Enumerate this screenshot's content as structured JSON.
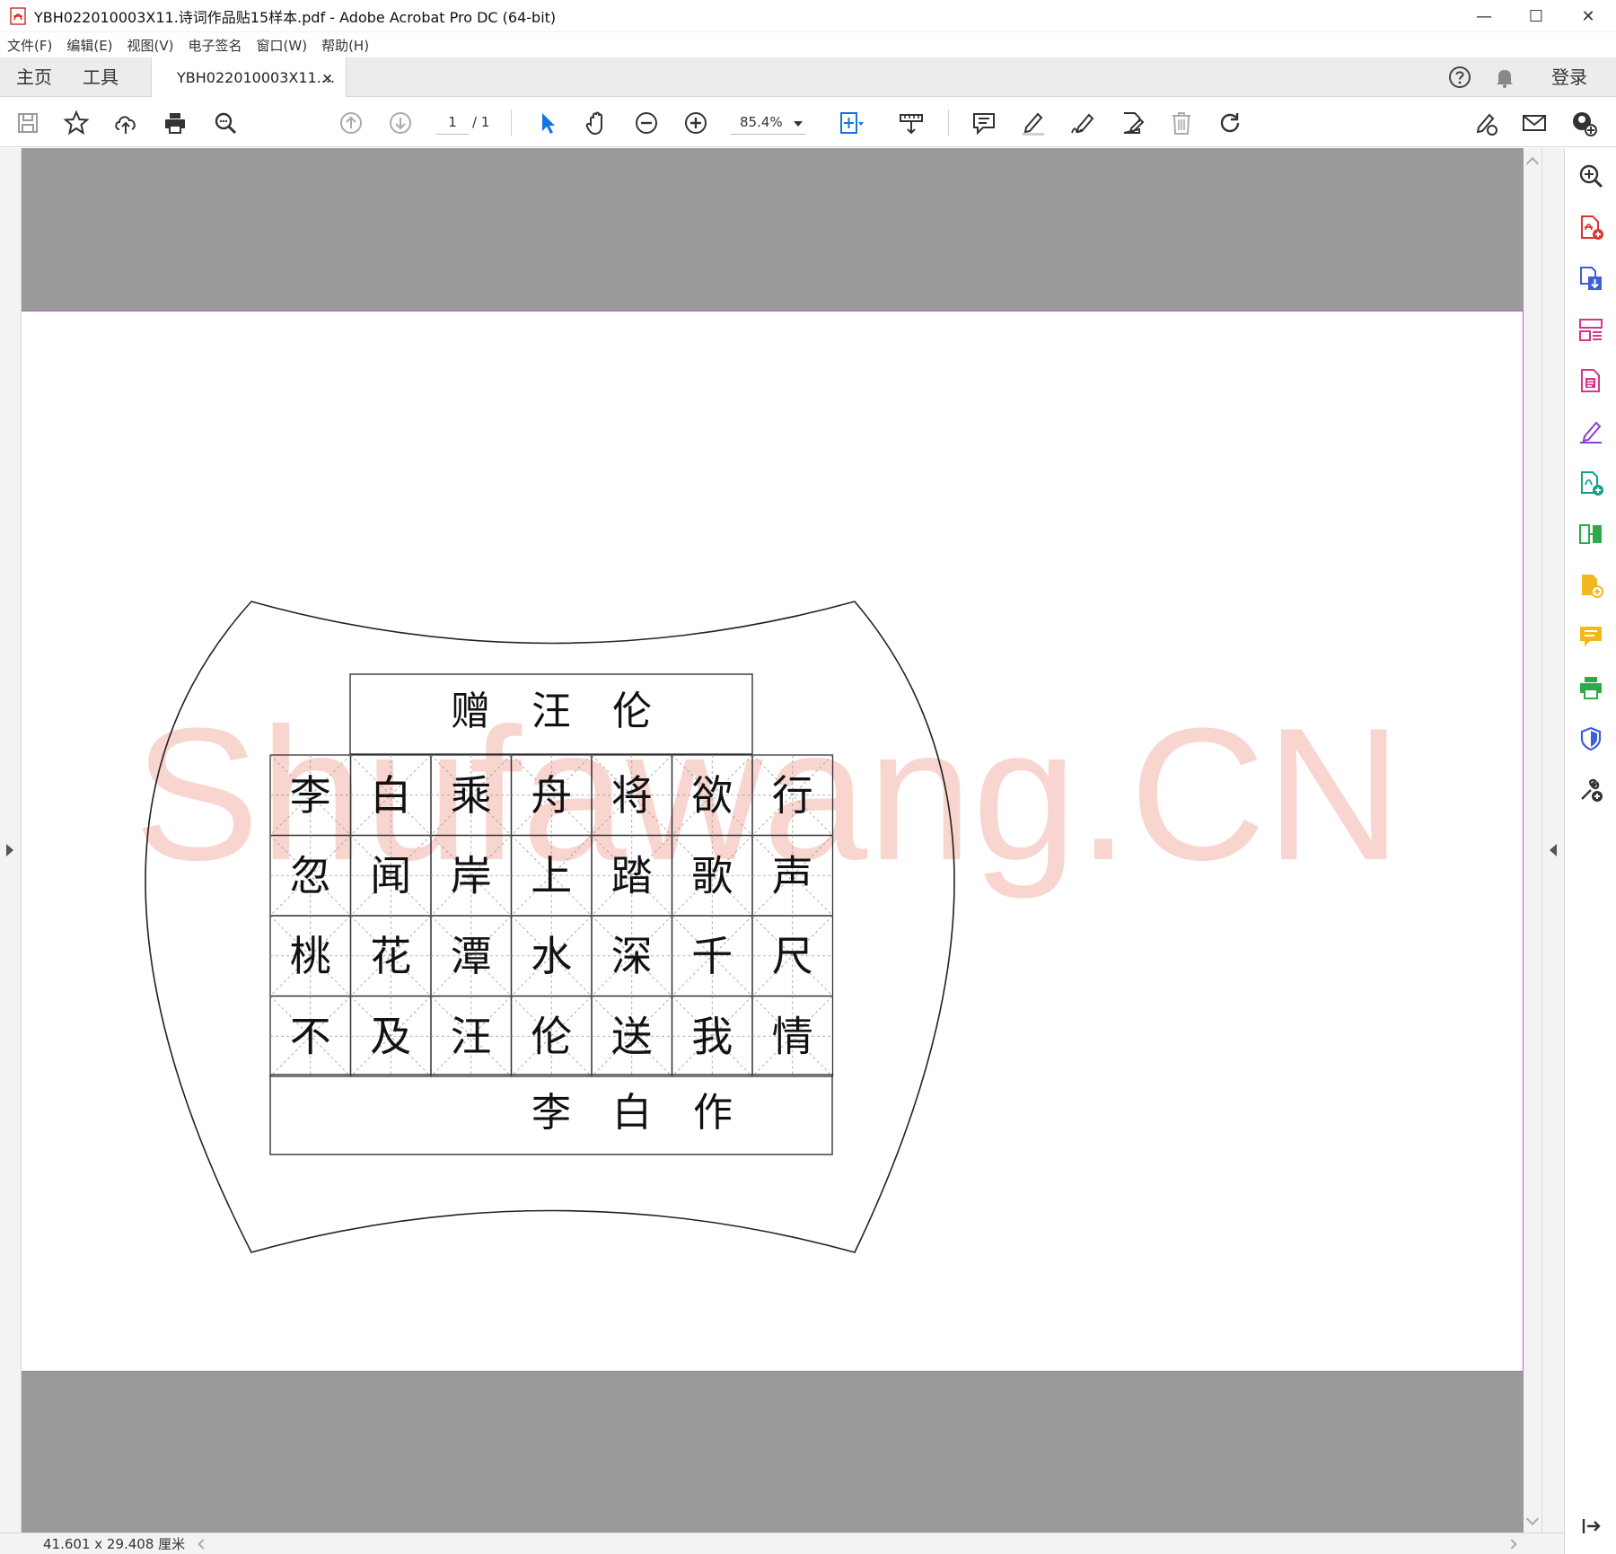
{
  "window": {
    "title": "YBH022010003X11.诗词作品贴15样本.pdf - Adobe Acrobat Pro DC (64-bit)",
    "controls": {
      "minimize": "—",
      "maximize": "☐",
      "close": "✕"
    }
  },
  "menu": [
    "文件(F)",
    "编辑(E)",
    "视图(V)",
    "电子签名",
    "窗口(W)",
    "帮助(H)"
  ],
  "tabs": {
    "home": "主页",
    "tools": "工具",
    "document": "YBH022010003X11....",
    "close": "×",
    "signin": "登录"
  },
  "toolbar": {
    "page_current": "1",
    "page_total": "/ 1",
    "zoom": "85.4%"
  },
  "document": {
    "poem_title": [
      "赠",
      "汪",
      "伦"
    ],
    "poem_rows": [
      [
        "李",
        "白",
        "乘",
        "舟",
        "将",
        "欲",
        "行"
      ],
      [
        "忽",
        "闻",
        "岸",
        "上",
        "踏",
        "歌",
        "声"
      ],
      [
        "桃",
        "花",
        "潭",
        "水",
        "深",
        "千",
        "尺"
      ],
      [
        "不",
        "及",
        "汪",
        "伦",
        "送",
        "我",
        "情"
      ]
    ],
    "signature": [
      "李",
      "白",
      "作"
    ],
    "watermark": "Shufawang.CN"
  },
  "status": {
    "dimensions": "41.601 x 29.408 厘米"
  },
  "colors": {
    "accent_blue": "#1473e6",
    "watermark": "#f6c8c0",
    "page_border": "#c65bc6",
    "canvas_bg": "#9a9a9a"
  },
  "right_tools": [
    "enhance-scans-icon",
    "create-pdf-icon",
    "export-pdf-icon",
    "organize-pages-icon",
    "edit-pdf-icon",
    "fill-sign-icon",
    "combine-files-icon",
    "compare-files-icon",
    "create-pdf-plus-icon",
    "comment-icon",
    "print-production-icon",
    "protect-icon",
    "more-tools-icon"
  ]
}
